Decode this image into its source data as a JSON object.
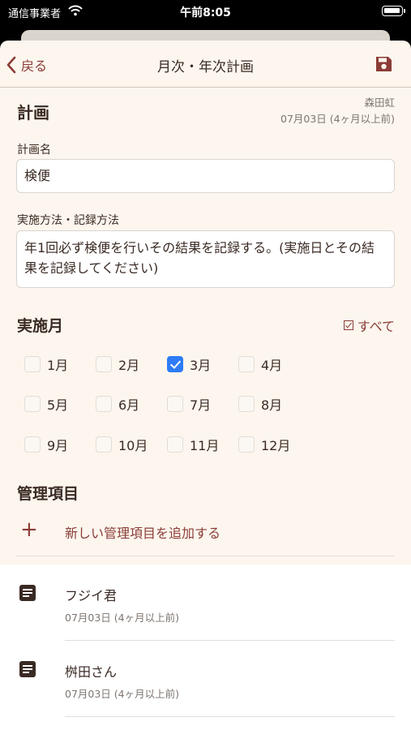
{
  "status_bar": {
    "carrier": "通信事業者",
    "time": "午前8:05"
  },
  "nav": {
    "back_label": "戻る",
    "title": "月次・年次計画"
  },
  "plan": {
    "section_title": "計画",
    "author": "森田虹",
    "created": "07月03日 (4ヶ月以上前)",
    "name_label": "計画名",
    "name_value": "検便",
    "method_label": "実施方法・記録方法",
    "method_value": "年1回必ず検便を行いその結果を記録する。(実施日とその結果を記録してください)"
  },
  "months_section": {
    "title": "実施月",
    "select_all_label": "すべて",
    "months": [
      {
        "label": "1月",
        "checked": false
      },
      {
        "label": "2月",
        "checked": false
      },
      {
        "label": "3月",
        "checked": true
      },
      {
        "label": "4月",
        "checked": false
      },
      {
        "label": "5月",
        "checked": false
      },
      {
        "label": "6月",
        "checked": false
      },
      {
        "label": "7月",
        "checked": false
      },
      {
        "label": "8月",
        "checked": false
      },
      {
        "label": "9月",
        "checked": false
      },
      {
        "label": "10月",
        "checked": false
      },
      {
        "label": "11月",
        "checked": false
      },
      {
        "label": "12月",
        "checked": false
      }
    ]
  },
  "management": {
    "title": "管理項目",
    "add_label": "新しい管理項目を追加する",
    "items": [
      {
        "name": "フジイ君",
        "date": "07月03日 (4ヶ月以上前)",
        "icon": "document-icon"
      },
      {
        "name": "桝田さん",
        "date": "07月03日 (4ヶ月以上前)",
        "icon": "document-icon"
      }
    ]
  },
  "colors": {
    "accent": "#8b3c37",
    "background": "#fcf6ee",
    "check": "#2d7cf6"
  }
}
